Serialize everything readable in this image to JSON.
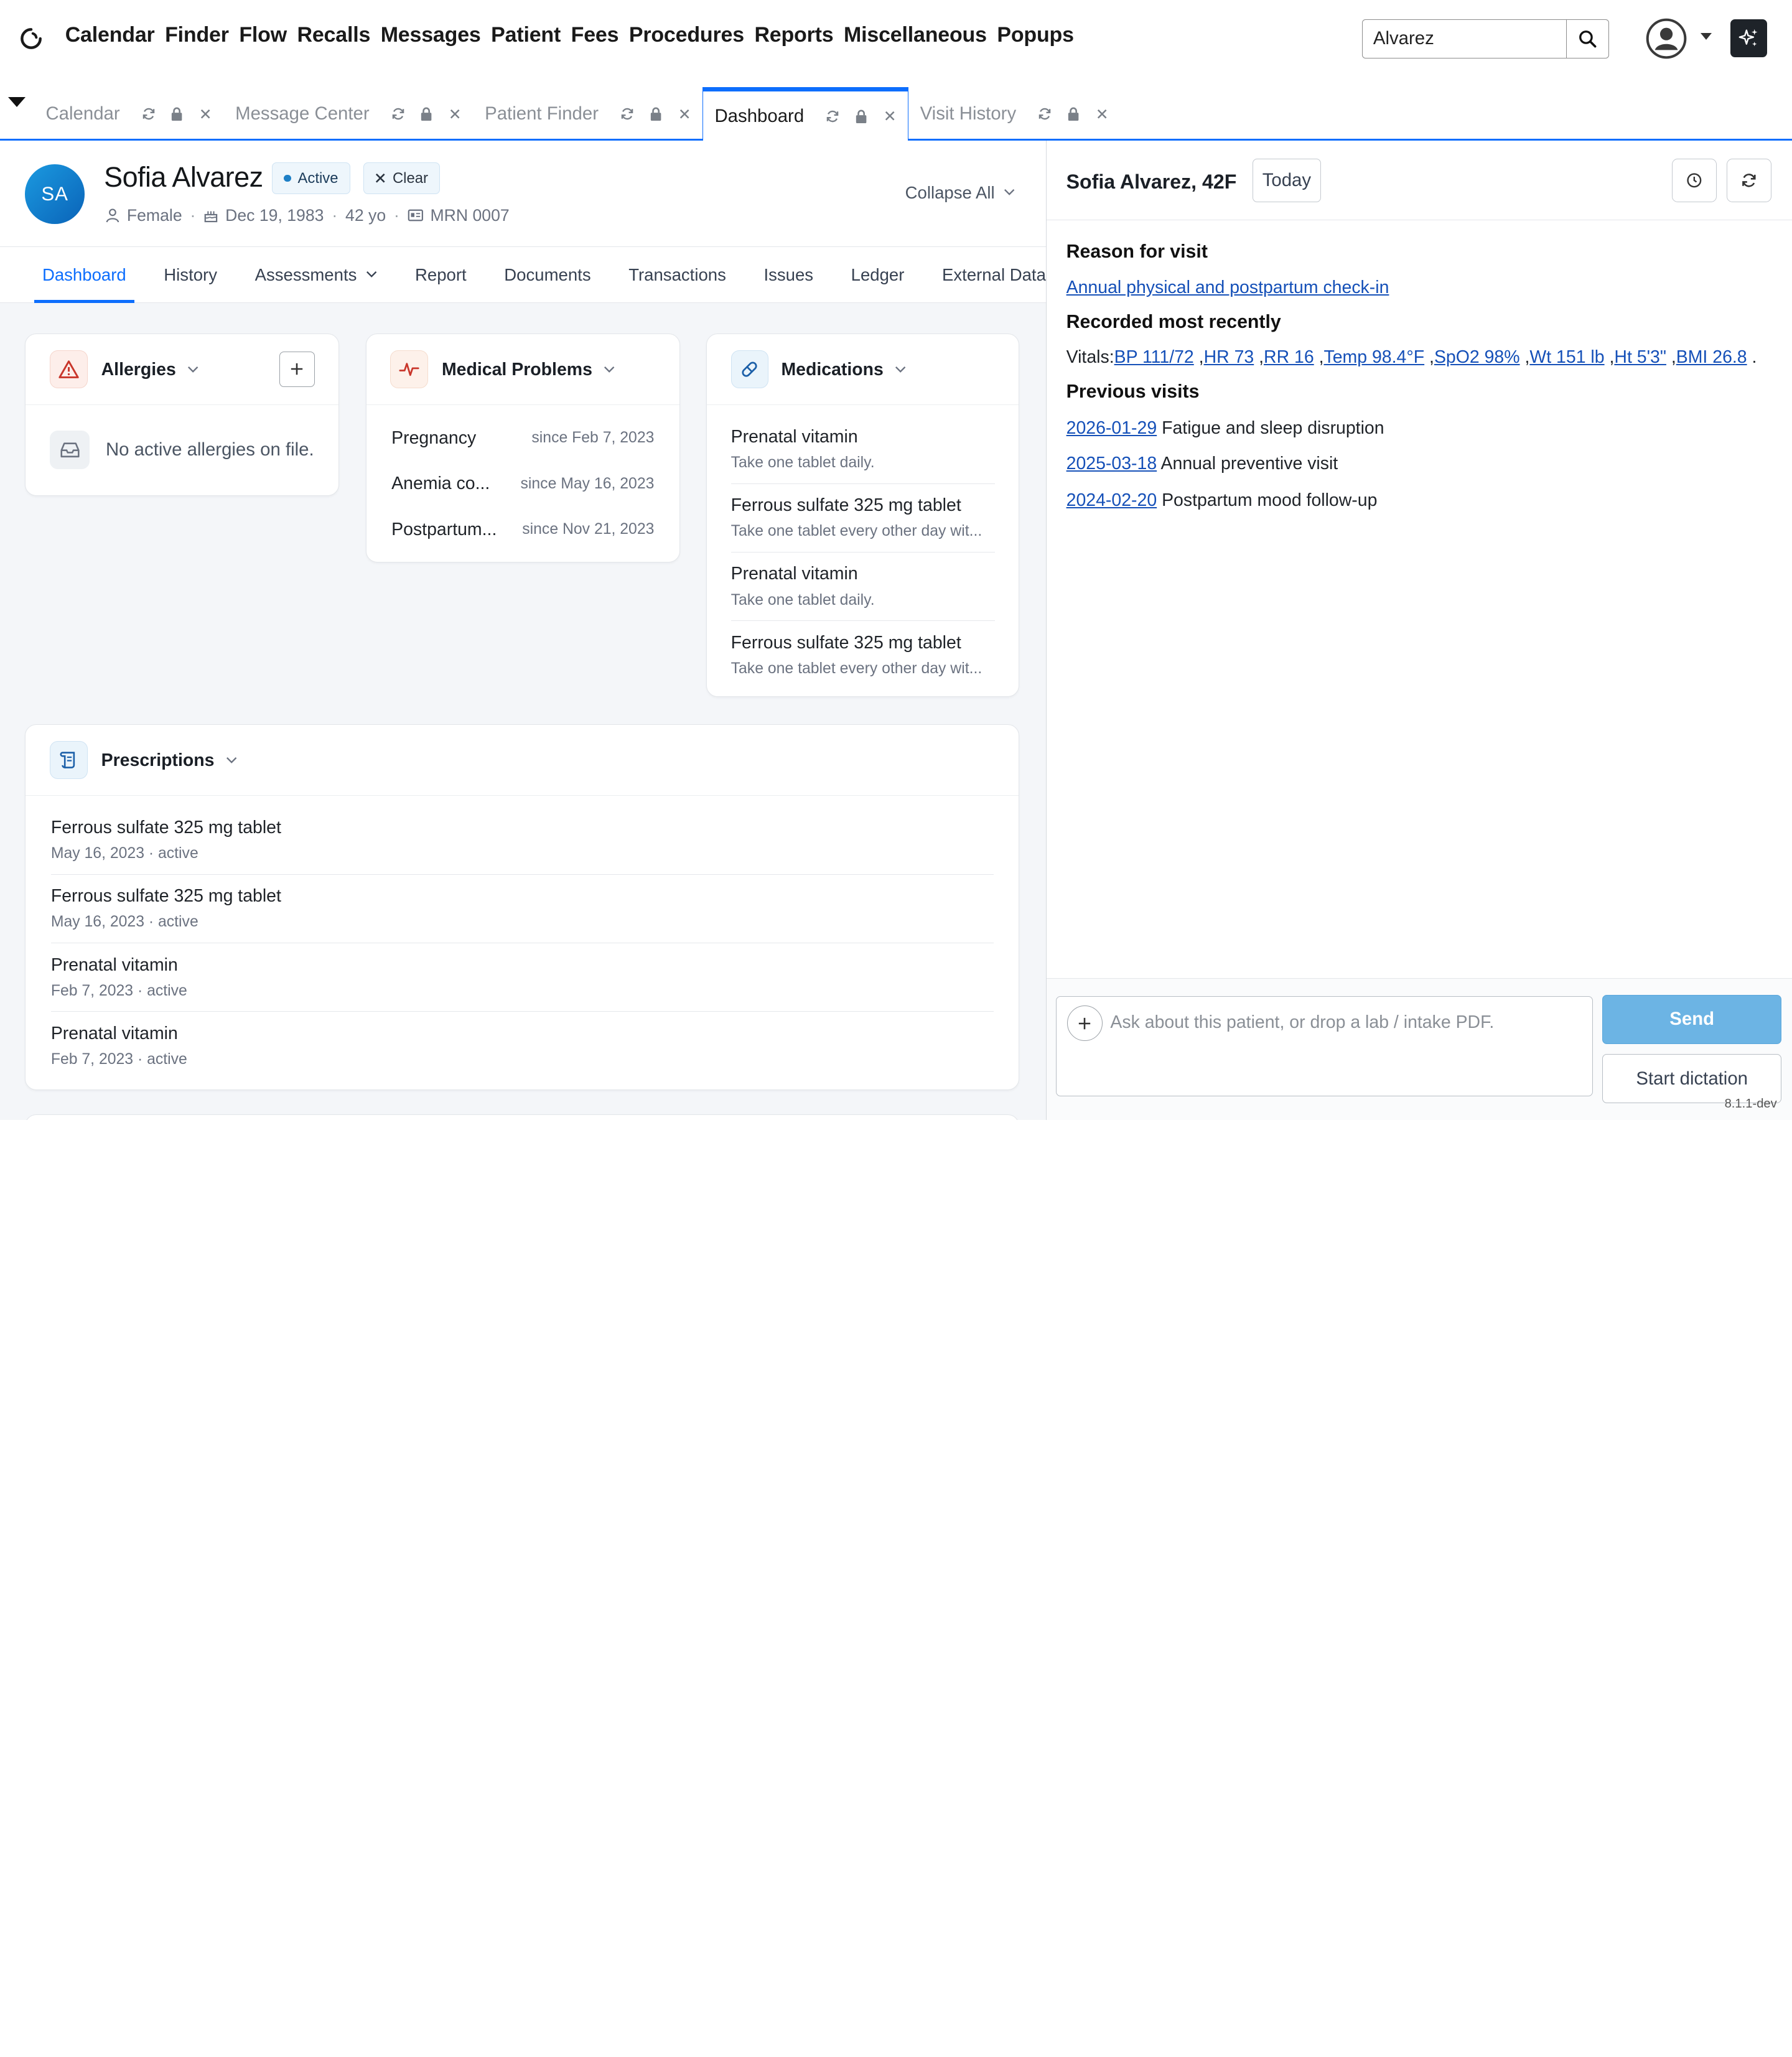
{
  "menu": {
    "items": [
      "Calendar",
      "Finder",
      "Flow",
      "Recalls",
      "Messages",
      "Patient",
      "Fees",
      "Procedures",
      "Reports",
      "Miscellaneous",
      "Popups"
    ]
  },
  "search": {
    "value": "Alvarez"
  },
  "icons": {
    "logo": "logo-ring-icon",
    "search": "search-icon",
    "user": "user-circle-icon",
    "ai": "sparkles-icon",
    "refresh": "refresh-icon",
    "lock": "lock-icon",
    "close": "close-icon"
  },
  "tabs": [
    {
      "label": "Calendar",
      "active": false
    },
    {
      "label": "Message Center",
      "active": false
    },
    {
      "label": "Patient Finder",
      "active": false
    },
    {
      "label": "Dashboard",
      "active": true
    },
    {
      "label": "Visit History",
      "active": false
    }
  ],
  "patient": {
    "initials": "SA",
    "name": "Sofia Alvarez",
    "status": "Active",
    "clear_label": "Clear",
    "sex": "Female",
    "dob": "Dec 19, 1983",
    "age": "42 yo",
    "mrn": "MRN 0007",
    "collapse_label": "Collapse All"
  },
  "subnav": {
    "items": [
      "Dashboard",
      "History",
      "Assessments",
      "Report",
      "Documents",
      "Transactions",
      "Issues",
      "Ledger",
      "External Data"
    ]
  },
  "cards": {
    "allergies": {
      "title": "Allergies",
      "empty_text": "No active allergies on file."
    },
    "problems": {
      "title": "Medical Problems",
      "items": [
        {
          "name": "Pregnancy",
          "since": "since Feb 7, 2023"
        },
        {
          "name": "Anemia co...",
          "since": "since May 16, 2023"
        },
        {
          "name": "Postpartum...",
          "since": "since Nov 21, 2023"
        }
      ]
    },
    "medications": {
      "title": "Medications",
      "items": [
        {
          "name": "Prenatal vitamin",
          "sig": "Take one tablet daily."
        },
        {
          "name": "Ferrous sulfate 325 mg tablet",
          "sig": "Take one tablet every other day wit..."
        },
        {
          "name": "Prenatal vitamin",
          "sig": "Take one tablet daily."
        },
        {
          "name": "Ferrous sulfate 325 mg tablet",
          "sig": "Take one tablet every other day wit..."
        }
      ]
    },
    "prescriptions": {
      "title": "Prescriptions",
      "items": [
        {
          "name": "Ferrous sulfate 325 mg tablet",
          "sub": "May 16, 2023 · active"
        },
        {
          "name": "Ferrous sulfate 325 mg tablet",
          "sub": "May 16, 2023 · active"
        },
        {
          "name": "Prenatal vitamin",
          "sub": "Feb 7, 2023 · active"
        },
        {
          "name": "Prenatal vitamin",
          "sub": "Feb 7, 2023 · active"
        }
      ]
    }
  },
  "assistant": {
    "title": "Sofia Alvarez, 42F",
    "today_label": "Today",
    "reason_heading": "Reason for visit",
    "reason_text": "Annual physical and postpartum check-in",
    "recent_heading": "Recorded most recently",
    "vitals_label": "Vitals:",
    "vitals": [
      "BP 111/72",
      "HR 73",
      "RR 16",
      "Temp 98.4°F",
      "SpO2 98%",
      "Wt 151 lb",
      "Ht 5'3\"",
      "BMI 26.8"
    ],
    "previous_heading": "Previous visits",
    "previous": [
      {
        "date": "2026-01-29",
        "text": "Fatigue and sleep disruption"
      },
      {
        "date": "2025-03-18",
        "text": "Annual preventive visit"
      },
      {
        "date": "2024-02-20",
        "text": "Postpartum mood follow-up"
      }
    ],
    "chat_placeholder": "Ask about this patient, or drop a lab / intake PDF.",
    "send_label": "Send",
    "dictation_label": "Start dictation"
  },
  "version": "8.1.1-dev"
}
